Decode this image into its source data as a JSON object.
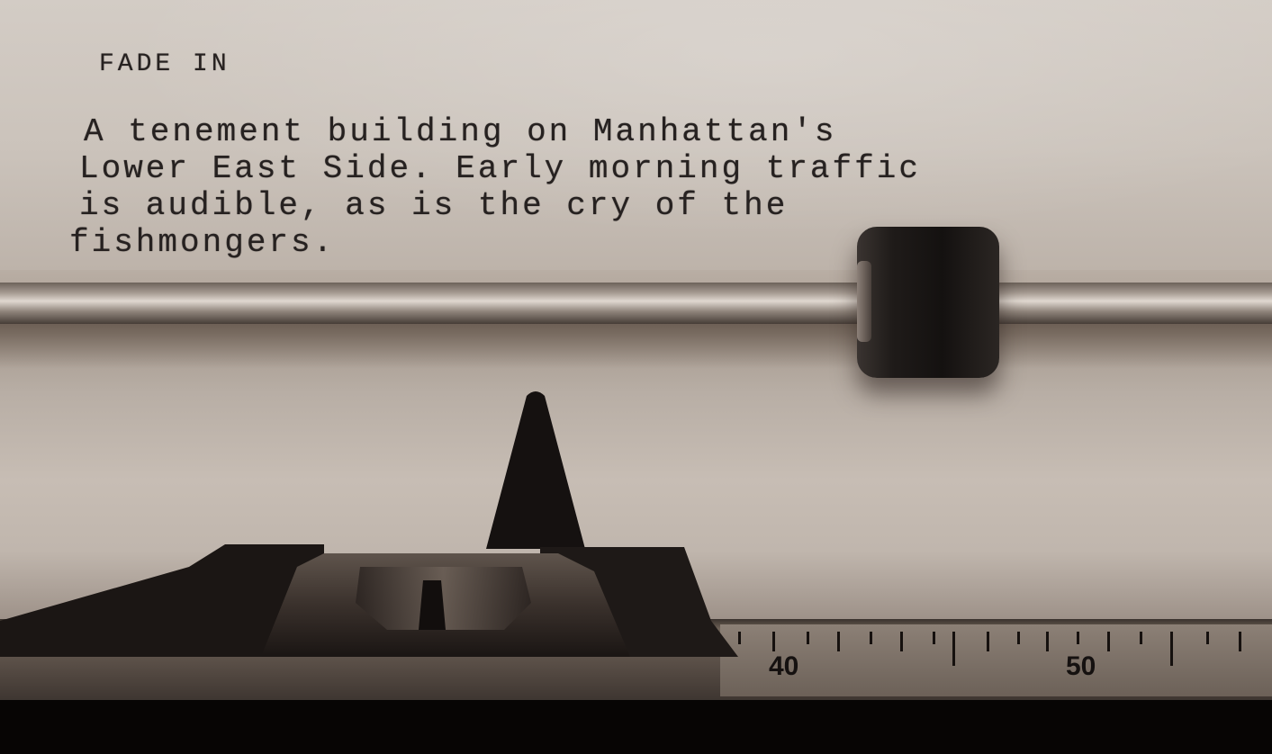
{
  "page": {
    "heading": "FADE IN",
    "lines": [
      "A tenement building on Manhattan's",
      "Lower East Side. Early morning traffic",
      "is audible, as is the cry of the",
      "fishmongers."
    ]
  },
  "scale": {
    "labels": [
      "40",
      "50"
    ]
  },
  "colors": {
    "paper": "#cfc7bf",
    "ink": "#262120",
    "roller": "#1f1b19"
  }
}
